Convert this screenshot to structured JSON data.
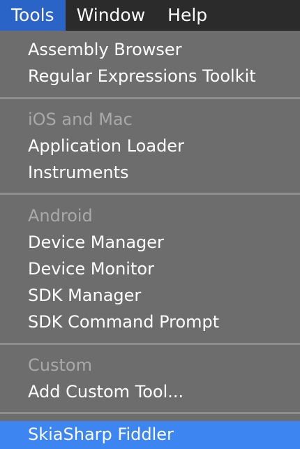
{
  "menubar": {
    "tools": "Tools",
    "window": "Window",
    "help": "Help"
  },
  "menu": {
    "assembly_browser": "Assembly Browser",
    "regex_toolkit": "Regular Expressions Toolkit",
    "ios_mac_header": "iOS and Mac",
    "application_loader": "Application Loader",
    "instruments": "Instruments",
    "android_header": "Android",
    "device_manager": "Device Manager",
    "device_monitor": "Device Monitor",
    "sdk_manager": "SDK Manager",
    "sdk_command_prompt": "SDK Command Prompt",
    "custom_header": "Custom",
    "add_custom_tool": "Add Custom Tool...",
    "skiasharp_fiddler": "SkiaSharp Fiddler"
  },
  "colors": {
    "menubar_bg": "#2b2b2b",
    "active_menu_bg": "#2a64c7",
    "panel_bg": "#6d6d6d",
    "highlight_bg": "#3d86f2",
    "header_text": "#a9a9a9",
    "item_text": "#ffffff",
    "separator": "#8e8e8e"
  }
}
